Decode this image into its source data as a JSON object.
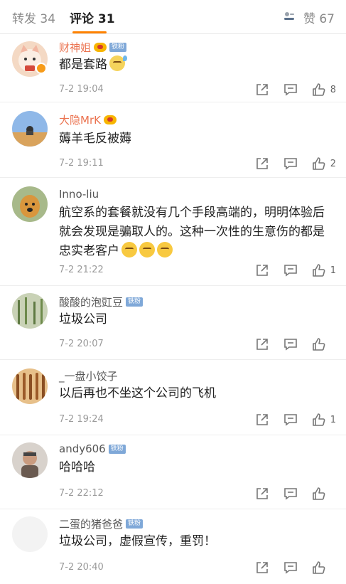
{
  "tabs": {
    "repost": "转发 34",
    "comment": "评论 31",
    "like": "赞 67"
  },
  "comments": [
    {
      "name": "财神姐",
      "badge": "铁粉",
      "text": "都是套路",
      "time": "7-2 19:04",
      "likes": "8"
    },
    {
      "name": "大隐MrK",
      "text": "薅羊毛反被薅",
      "time": "7-2 19:11",
      "likes": "2"
    },
    {
      "name": "Inno-liu",
      "text": "航空系的套餐就没有几个手段高端的，明明体验后就会发现是骗取人的。这种一次性的生意伤的都是忠实老客户",
      "time": "7-2 21:22",
      "likes": "1"
    },
    {
      "name": "酸酸的泡豇豆",
      "badge": "铁粉",
      "text": "垃圾公司",
      "time": "7-2 20:07",
      "likes": ""
    },
    {
      "name": "_一盘小饺子",
      "text": "以后再也不坐这个公司的飞机",
      "time": "7-2 19:24",
      "likes": "1"
    },
    {
      "name": "andy606",
      "badge": "铁粉",
      "text": "哈哈哈",
      "time": "7-2 22:12",
      "likes": ""
    },
    {
      "name": "二蛋的猪爸爸",
      "badge": "铁粉",
      "text": "垃圾公司，虚假宣传，重罚！",
      "time": "7-2 20:40",
      "likes": ""
    }
  ],
  "colors": {
    "accent": "#ff8200",
    "vip_name": "#eb7350",
    "fan_badge": "#7fa8d8"
  }
}
